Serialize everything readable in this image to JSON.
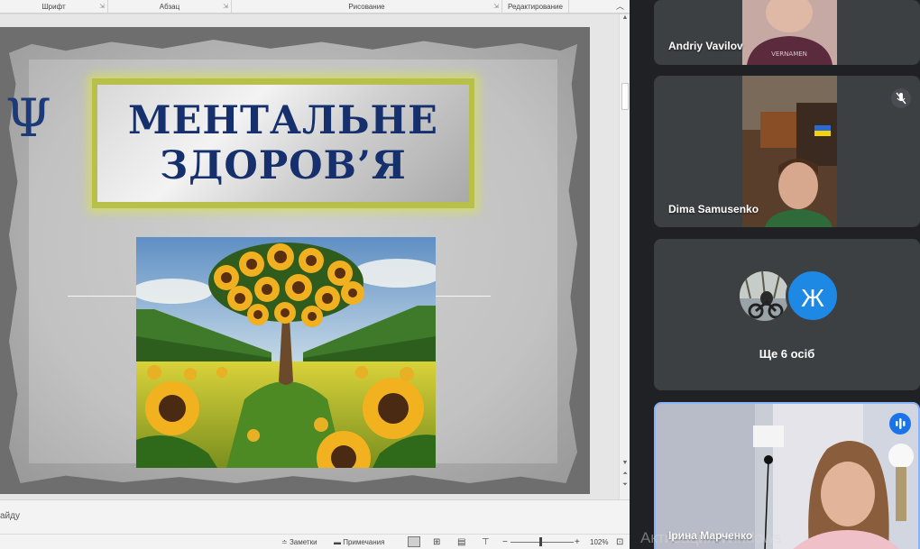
{
  "ribbon": {
    "groups": [
      "Шрифт",
      "Абзац",
      "Рисование",
      "Редактирование"
    ],
    "collapse_icon": "chevron-up-icon"
  },
  "slide": {
    "symbol": "Ψ",
    "title_line1": "МЕНТАЛЬНЕ",
    "title_line2": "ЗДОРОВ’Я",
    "colors": {
      "title_text": "#16306e",
      "frame_glow": "#d6de5c",
      "paper": "#c2c2c2"
    }
  },
  "statusbar": {
    "notes_hint": "айду",
    "notes_label": "Заметки",
    "comments_label": "Примечания",
    "zoom_minus": "−",
    "zoom_plus": "+",
    "zoom_value": "102%"
  },
  "meet": {
    "participants": [
      {
        "name": "Andriy Vavilov"
      },
      {
        "name": "Dima Samusenko",
        "muted": true
      },
      {
        "more_label": "Ще 6 осіб",
        "avatar_letter": "Ж"
      },
      {
        "name": "Ірина Марченко",
        "speaking": true
      }
    ],
    "watermark": "Активация Windows",
    "colors": {
      "tile": "#3c4043",
      "background": "#202124",
      "accent": "#1a73e8"
    }
  }
}
